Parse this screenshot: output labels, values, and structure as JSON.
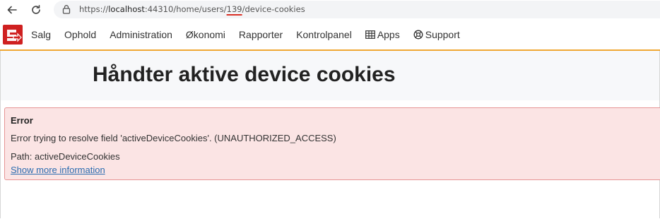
{
  "browser": {
    "url_prefix": "https://",
    "url_host": "localhost",
    "url_path_before": ":44310/home/users/",
    "url_highlight": "139",
    "url_path_after": "/device-cookies",
    "back_icon": "back-arrow-icon",
    "reload_icon": "reload-icon",
    "lock_icon": "lock-icon"
  },
  "nav": {
    "logo_icon": "app-logo-icon",
    "items": [
      {
        "label": "Salg"
      },
      {
        "label": "Ophold"
      },
      {
        "label": "Administration"
      },
      {
        "label": "Økonomi"
      },
      {
        "label": "Rapporter"
      },
      {
        "label": "Kontrolpanel"
      },
      {
        "label": "Apps",
        "icon": "grid-icon"
      },
      {
        "label": "Support",
        "icon": "lifebuoy-icon"
      }
    ],
    "accent_color": "#f0a733"
  },
  "page": {
    "title": "Håndter aktive device cookies"
  },
  "error": {
    "title": "Error",
    "message": "Error trying to resolve field 'activeDeviceCookies'. (UNAUTHORIZED_ACCESS)",
    "path": "Path: activeDeviceCookies",
    "link": "Show more information",
    "background": "#fbe4e4",
    "border": "#e69595"
  }
}
